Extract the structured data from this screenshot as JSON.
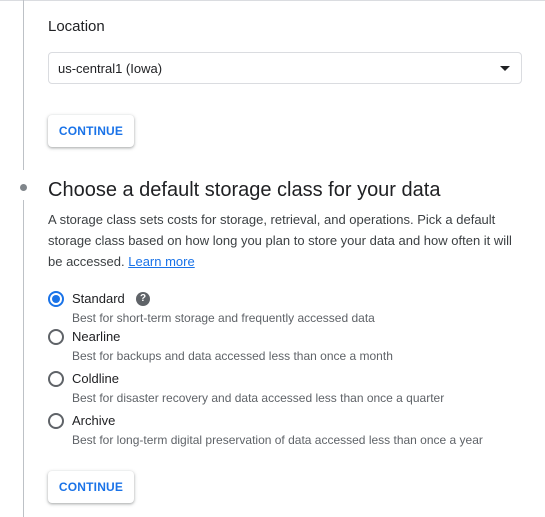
{
  "location": {
    "label": "Location",
    "selected": "us-central1 (Iowa)"
  },
  "continue_label": "CONTINUE",
  "storage_class": {
    "title": "Choose a default storage class for your data",
    "description": "A storage class sets costs for storage, retrieval, and operations. Pick a default storage class based on how long you plan to store your data and how often it will be accessed.",
    "learn_more": "Learn more",
    "help_icon": "?",
    "selected": "Standard",
    "options": [
      {
        "name": "Standard",
        "description": "Best for short-term storage and frequently accessed data"
      },
      {
        "name": "Nearline",
        "description": "Best for backups and data accessed less than once a month"
      },
      {
        "name": "Coldline",
        "description": "Best for disaster recovery and data accessed less than once a quarter"
      },
      {
        "name": "Archive",
        "description": "Best for long-term digital preservation of data accessed less than once a year"
      }
    ]
  },
  "colors": {
    "accent": "#1a73e8",
    "text": "#202124",
    "secondary_text": "#5f6368"
  }
}
